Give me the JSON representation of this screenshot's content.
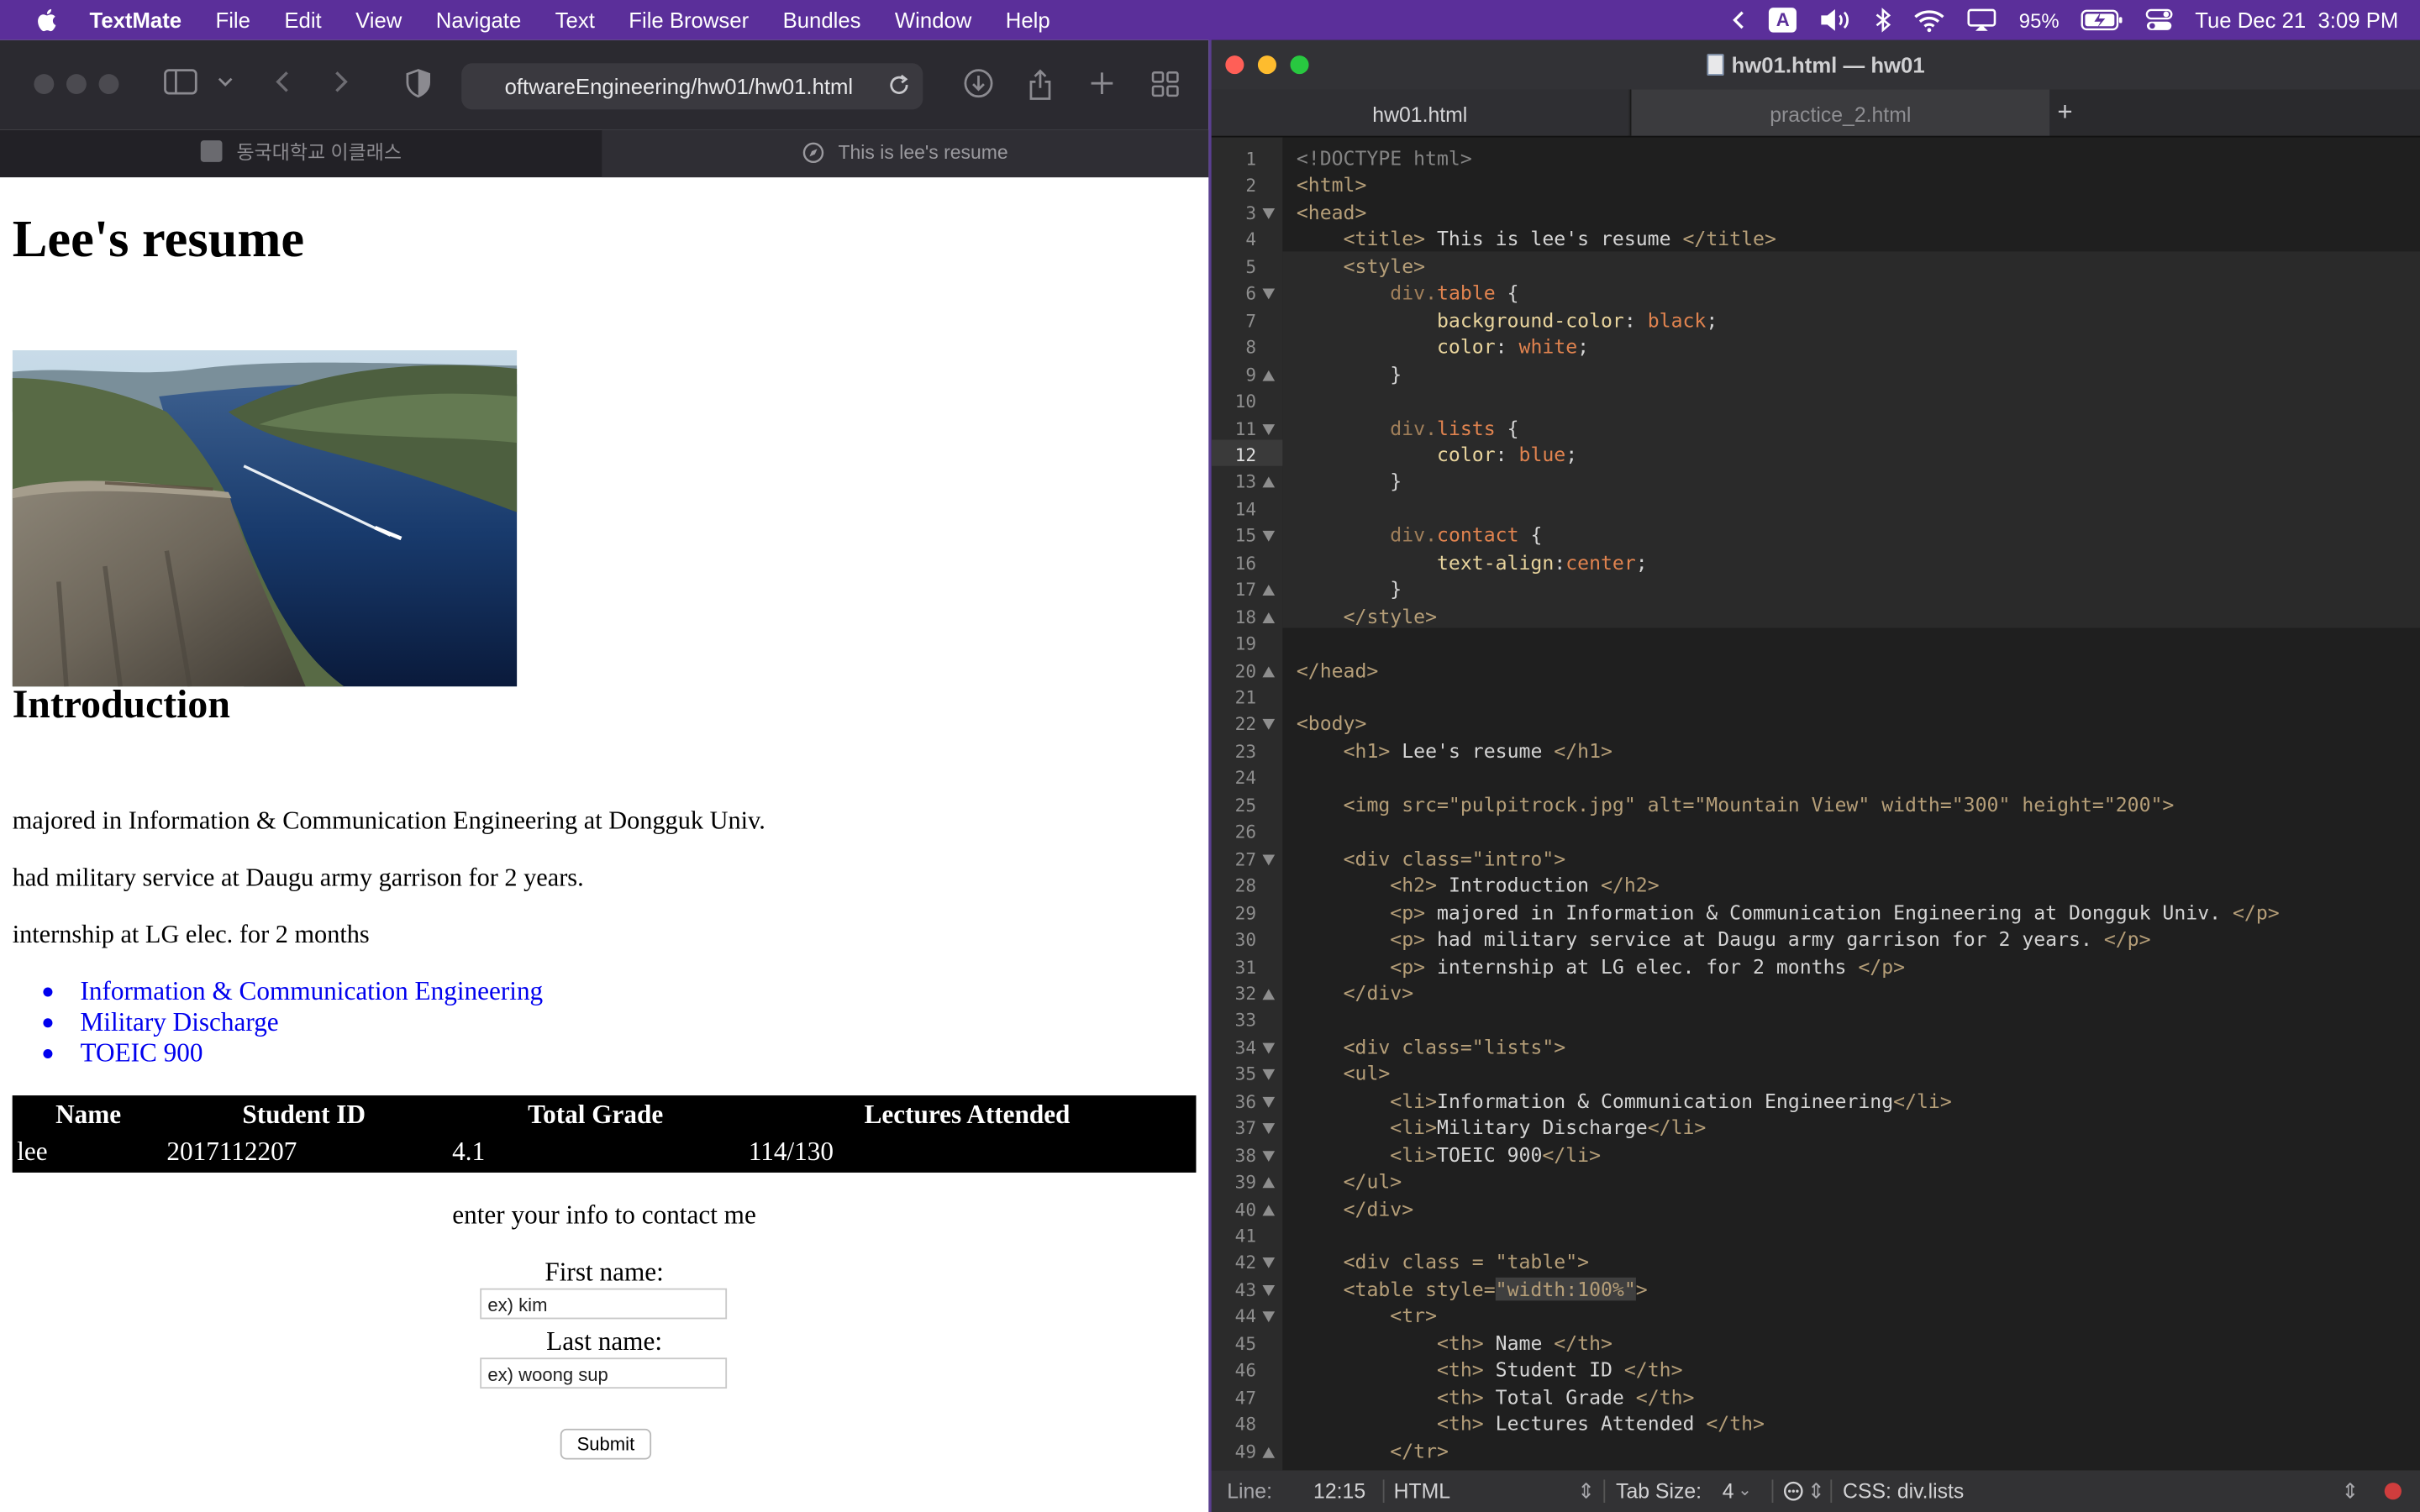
{
  "menubar": {
    "app_name": "TextMate",
    "items": [
      "File",
      "Edit",
      "View",
      "Navigate",
      "Text",
      "File Browser",
      "Bundles",
      "Window",
      "Help"
    ],
    "input_source": "A",
    "battery": "95%",
    "datetime": "Tue Dec 21  3:09 PM"
  },
  "safari": {
    "url": "oftwareEngineering/hw01/hw01.html",
    "tabs": [
      {
        "label": "동국대학교 이클래스",
        "active": false
      },
      {
        "label": "This is lee's resume",
        "active": true
      }
    ],
    "page": {
      "h1": "Lee's resume",
      "image_alt": "Mountain View",
      "intro_heading": "Introduction",
      "intro_paragraphs": [
        "majored in Information & Communication Engineering at Dongguk Univ.",
        "had military service at Daugu army garrison for 2 years.",
        "internship at LG elec. for 2 months"
      ],
      "list_items": [
        "Information & Communication Engineering",
        "Military Discharge",
        "TOEIC 900"
      ],
      "table": {
        "headers": [
          "Name",
          "Student ID",
          "Total Grade",
          "Lectures Attended"
        ],
        "row": [
          "lee",
          "2017112207",
          "4.1",
          "114/130"
        ]
      },
      "contact": {
        "prompt": "enter your info to contact me",
        "first_label": "First name:",
        "first_value": "ex) kim",
        "last_label": "Last name:",
        "last_value": "ex) woong sup",
        "submit_label": "Submit"
      }
    }
  },
  "textmate": {
    "window_title": "hw01.html — hw01",
    "tabs": [
      {
        "label": "hw01.html",
        "active": true
      },
      {
        "label": "practice_2.html",
        "active": false
      }
    ],
    "add_tab_label": "+",
    "current_line": 12,
    "line_numbers": [
      1,
      2,
      3,
      4,
      5,
      6,
      7,
      8,
      9,
      10,
      11,
      12,
      13,
      14,
      15,
      16,
      17,
      18,
      19,
      20,
      21,
      22,
      23,
      24,
      25,
      26,
      27,
      28,
      29,
      30,
      31,
      32,
      33,
      34,
      35,
      36,
      37,
      38,
      39,
      40,
      41,
      42,
      43,
      44,
      45,
      46,
      47,
      48,
      49
    ],
    "code_lines": [
      "<!DOCTYPE html>",
      "<html>",
      "<head>",
      "    <title> This is lee's resume </title>",
      "    <style>",
      "        div.table {",
      "            background-color: black;",
      "            color: white;",
      "        }",
      "",
      "        div.lists {",
      "            color: blue;",
      "        }",
      "",
      "        div.contact {",
      "            text-align:center;",
      "        }",
      "    </style>",
      "",
      "</head>",
      "",
      "<body>",
      "    <h1> Lee's resume </h1>",
      "",
      "    <img src=\"pulpitrock.jpg\" alt=\"Mountain View\" width=\"300\" height=\"200\">",
      "",
      "    <div class=\"intro\">",
      "        <h2> Introduction </h2>",
      "        <p> majored in Information & Communication Engineering at Dongguk Univ. </p>",
      "        <p> had military service at Daugu army garrison for 2 years. </p>",
      "        <p> internship at LG elec. for 2 months </p>",
      "    </div>",
      "",
      "    <div class=\"lists\">",
      "    <ul>",
      "        <li>Information & Communication Engineering</li>",
      "        <li>Military Discharge</li>",
      "        <li>TOEIC 900</li>",
      "    </ul>",
      "    </div>",
      "",
      "    <div class = \"table\">",
      "    <table style=\"width:100%\">",
      "        <tr>",
      "            <th> Name </th>",
      "            <th> Student ID </th>",
      "            <th> Total Grade </th>",
      "            <th> Lectures Attended </th>",
      "        </tr>"
    ],
    "status": {
      "line_label": "Line:",
      "position": "12:15",
      "grammar": "HTML",
      "tab_size_label": "Tab Size:",
      "tab_size": "4",
      "scope": "CSS: div.lists"
    }
  }
}
